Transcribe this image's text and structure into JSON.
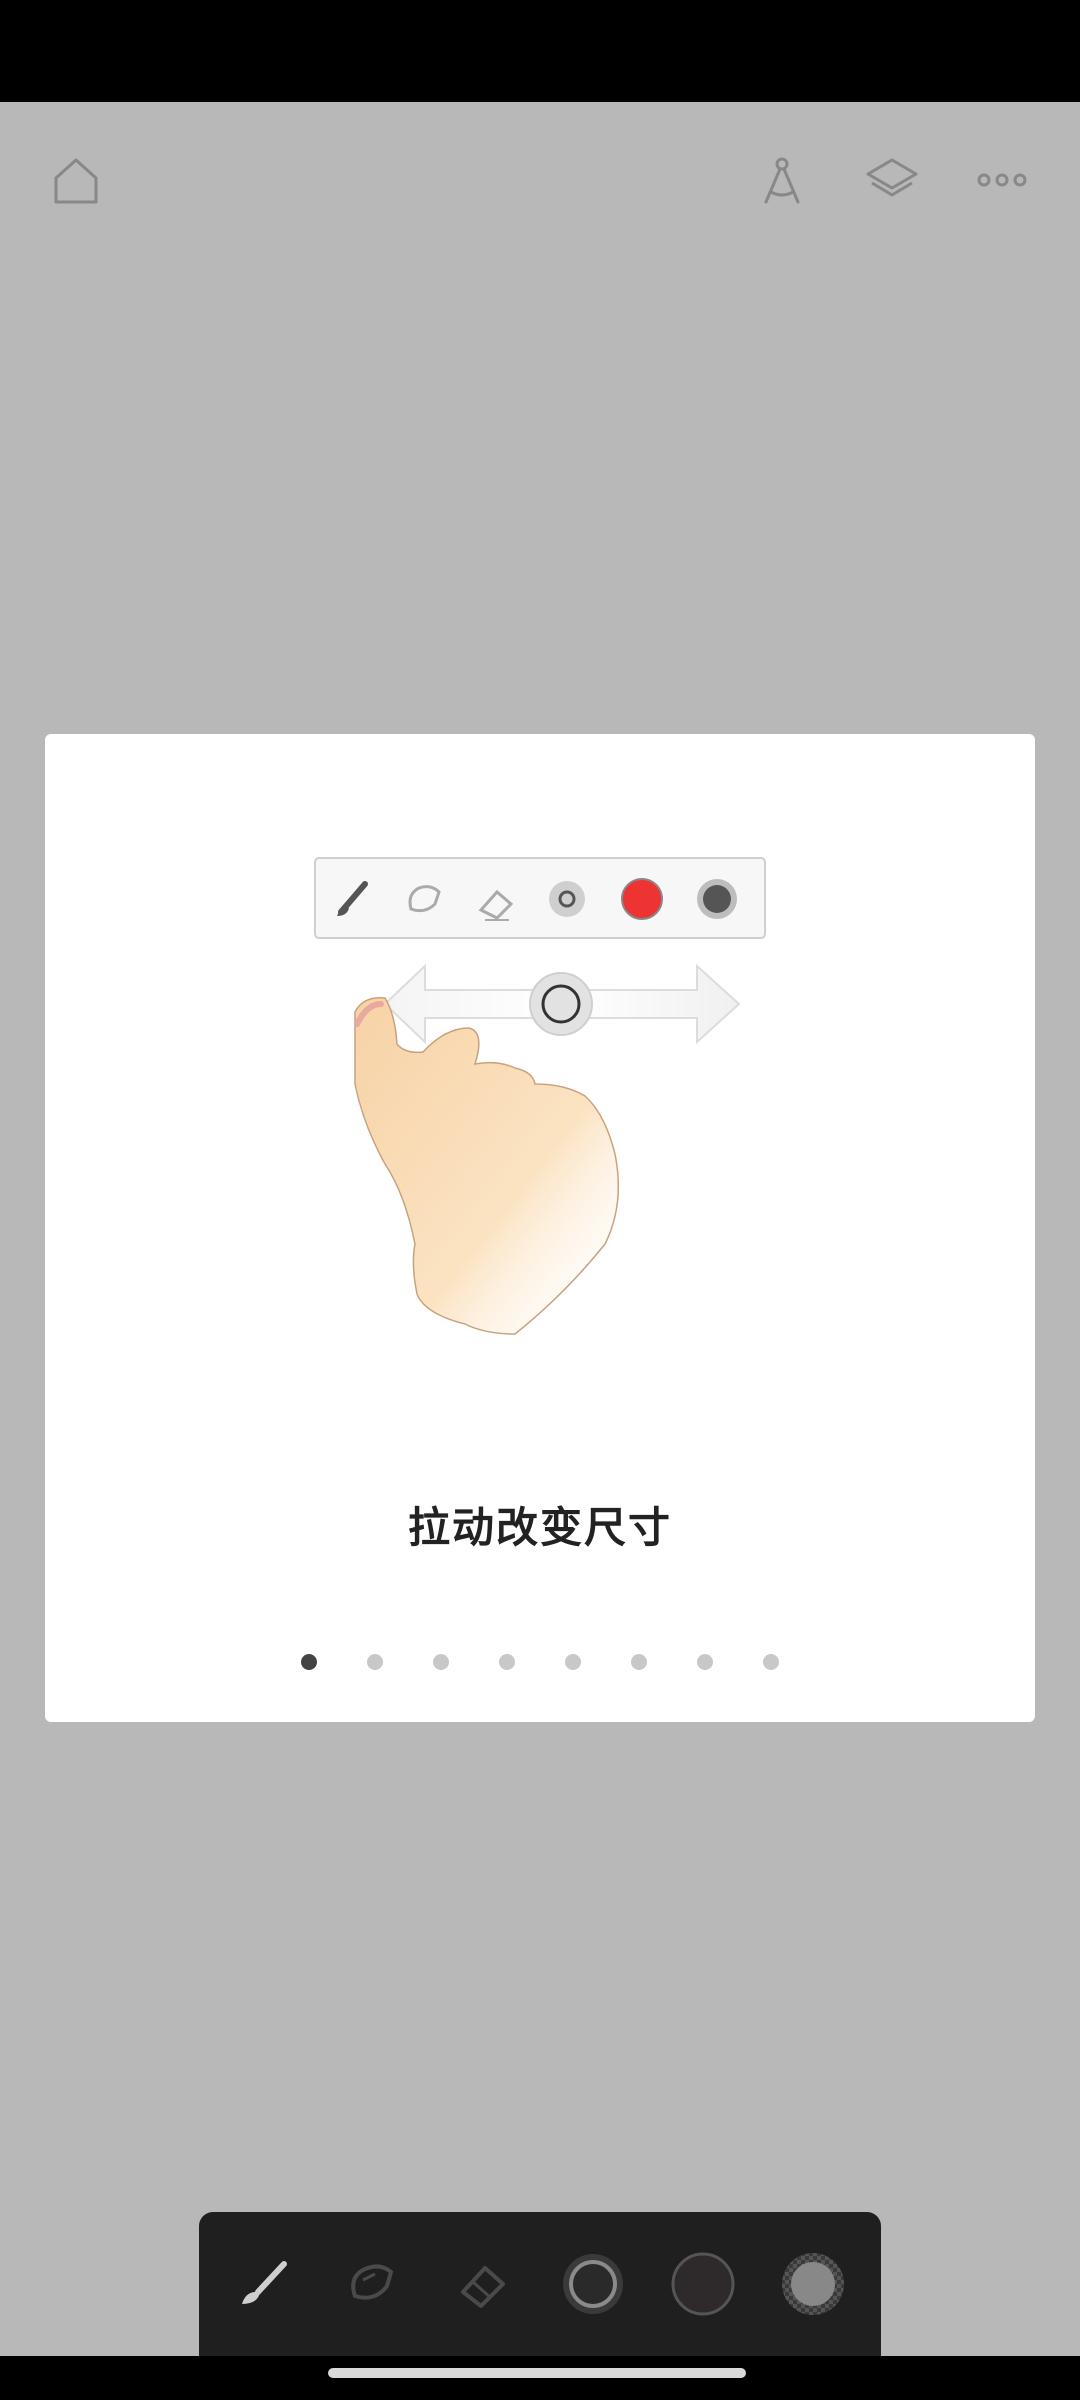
{
  "top_toolbar": {
    "icons": [
      "home-icon",
      "ruler-compass-icon",
      "layers-icon",
      "more-icon"
    ]
  },
  "tutorial": {
    "caption": "拉动改变尺寸",
    "page_count": 8,
    "active_page": 1,
    "illustration": {
      "toolbar_icons": [
        "brush-icon",
        "smudge-icon",
        "eraser-icon",
        "size-icon",
        "color-swatch-icon",
        "opacity-icon"
      ],
      "swatch_color": "#ee3333"
    }
  },
  "bottom_toolbar": {
    "icons": [
      "brush-icon",
      "smudge-icon",
      "eraser-icon",
      "brush-size-icon",
      "color-icon",
      "opacity-icon"
    ],
    "active_tool": "brush-icon",
    "color": "#2e2a2b"
  }
}
